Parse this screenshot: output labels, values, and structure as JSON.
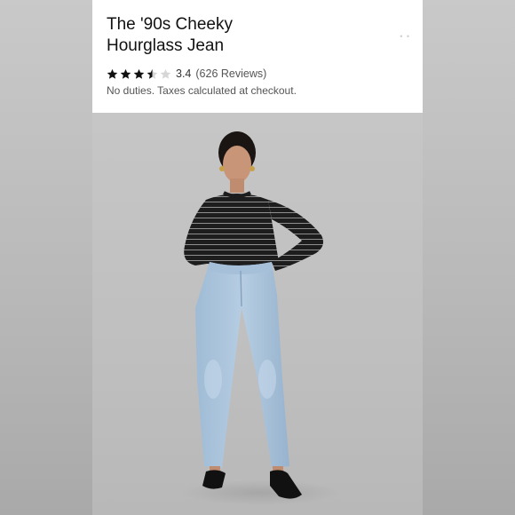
{
  "product": {
    "title_line1": "The '90s Cheeky",
    "title_line2": "Hourglass Jean",
    "rating_value": "3.4",
    "rating_fraction": 0.68,
    "reviews_text": "(626 Reviews)",
    "shipping_note": "No duties. Taxes calculated at checkout."
  },
  "colors": {
    "card_bg": "#ffffff",
    "star_filled": "#111111",
    "star_empty": "#d6d6d6",
    "denim": "#a9c4dd",
    "top": "#1f1f1f"
  },
  "icons": [
    "star-icon",
    "more-icon"
  ],
  "image": {
    "alt": "Model wearing light-wash high-rise jeans and a striped long-sleeve top"
  }
}
